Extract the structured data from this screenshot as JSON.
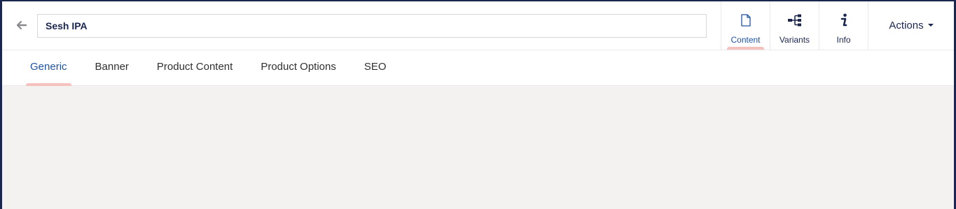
{
  "editor": {
    "name_value": "Sesh IPA",
    "back_icon": "arrow-left-icon"
  },
  "app_nav": [
    {
      "label": "Content",
      "icon": "document-icon",
      "active": true
    },
    {
      "label": "Variants",
      "icon": "sitemap-icon",
      "active": false
    },
    {
      "label": "Info",
      "icon": "info-icon",
      "active": false
    }
  ],
  "actions": {
    "label": "Actions",
    "icon": "caret-down-icon"
  },
  "tabs": [
    {
      "label": "Generic",
      "active": true
    },
    {
      "label": "Banner",
      "active": false
    },
    {
      "label": "Product Content",
      "active": false
    },
    {
      "label": "Product Options",
      "active": false
    },
    {
      "label": "SEO",
      "active": false
    }
  ],
  "colors": {
    "accent": "#2152a3",
    "active_indicator": "#f5c1bc",
    "text_dark": "#1b264f",
    "background": "#f3f2f0"
  }
}
